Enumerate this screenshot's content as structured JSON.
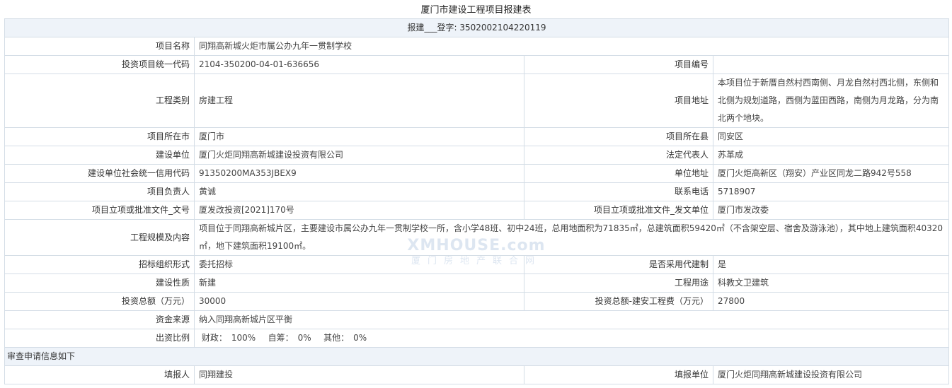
{
  "title": "厦门市建设工程项目报建表",
  "registration": {
    "label": "报建___登字:",
    "value": "3502002104220119"
  },
  "rows": {
    "project_name": {
      "label": "项目名称",
      "value": "同翔高新城火炬市属公办九年一贯制学校"
    },
    "invest_code": {
      "label": "投资项目统一代码",
      "value": "2104-350200-04-01-636656"
    },
    "project_no": {
      "label": "项目编号",
      "value": ""
    },
    "category": {
      "label": "工程类别",
      "value": "房建工程"
    },
    "address": {
      "label": "项目地址",
      "value": "本项目位于新厝自然村西南侧、月龙自然村西北侧，东侧和北侧为规划道路，西侧为蓝田西路，南侧为月龙路，分为南北两个地块。"
    },
    "city": {
      "label": "项目所在市",
      "value": "厦门市"
    },
    "county": {
      "label": "项目所在县",
      "value": "同安区"
    },
    "builder": {
      "label": "建设单位",
      "value": "厦门火炬同翔高新城建设投资有限公司"
    },
    "legal_rep": {
      "label": "法定代表人",
      "value": "苏革成"
    },
    "credit_code": {
      "label": "建设单位社会统一信用代码",
      "value": "91350200MA353JBEX9"
    },
    "unit_address": {
      "label": "单位地址",
      "value": "厦门火炬高新区（翔安）产业区同龙二路942号558"
    },
    "manager": {
      "label": "项目负责人",
      "value": "黄诚"
    },
    "phone": {
      "label": "联系电话",
      "value": "5718907"
    },
    "approval_doc": {
      "label": "项目立项或批准文件_文号",
      "value": "厦发改投资[2021]170号"
    },
    "approval_unit": {
      "label": "项目立项或批准文件_发文单位",
      "value": "厦门市发改委"
    },
    "scale": {
      "label": "工程规模及内容",
      "value": "项目位于同翔高新城片区，主要建设市属公办九年一贯制学校一所，含小学48班、初中24班，总用地面积为71835㎡，总建筑面积59420㎡（不含架空层、宿舍及游泳池），其中地上建筑面积40320㎡，地下建筑面积19100㎡。"
    },
    "bidding": {
      "label": "招标组织形式",
      "value": "委托招标"
    },
    "agent_build": {
      "label": "是否采用代建制",
      "value": "是"
    },
    "nature": {
      "label": "建设性质",
      "value": "新建"
    },
    "usage": {
      "label": "工程用途",
      "value": "科教文卫建筑"
    },
    "total_invest": {
      "label": "投资总额（万元）",
      "value": "30000"
    },
    "build_cost": {
      "label": "投资总额-建安工程费（万元）",
      "value": "27800"
    },
    "funding": {
      "label": "资金来源",
      "value": "纳入同翔高新城片区平衡"
    },
    "ratio": {
      "label": "出资比例",
      "fiscal_label": "财政：",
      "fiscal": "100%",
      "self_label": "自筹：",
      "self": "0%",
      "other_label": "其他：",
      "other": "0%"
    }
  },
  "review_section": "审查申请信息如下",
  "filler": {
    "label": "填报人",
    "value": "同翔建投"
  },
  "filler_unit": {
    "label": "填报单位",
    "value": "厦门火炬同翔高新城建设投资有限公司"
  },
  "watermark": {
    "line1": "XMHOUSE.com",
    "line2": "厦门房地产联合网"
  }
}
